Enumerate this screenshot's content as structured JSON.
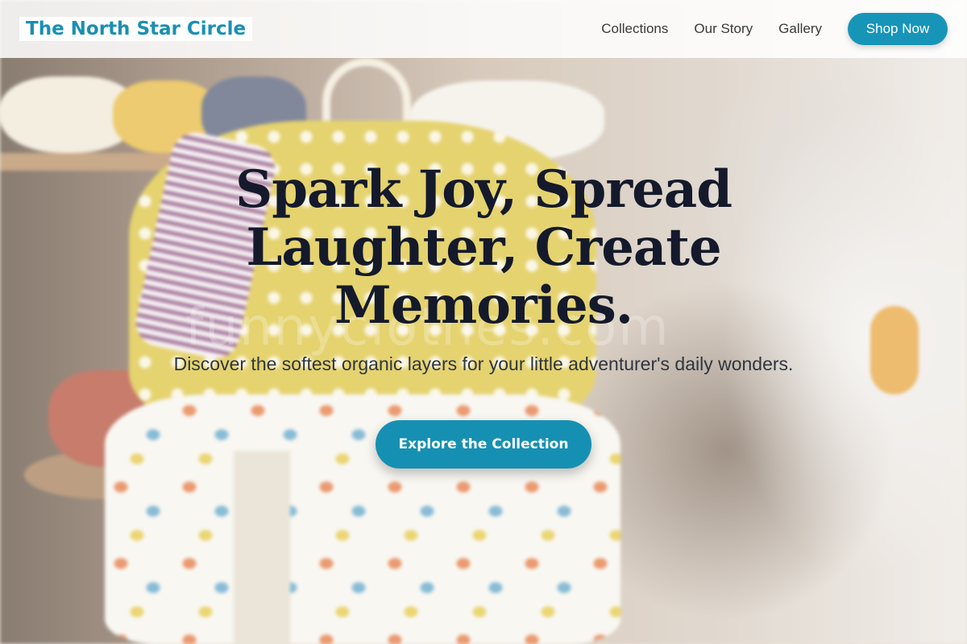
{
  "header": {
    "brand": "The North Star Circle",
    "nav": [
      {
        "label": "Collections"
      },
      {
        "label": "Our Story"
      },
      {
        "label": "Gallery"
      }
    ],
    "cta_label": "Shop Now"
  },
  "hero": {
    "title": "Spark Joy, Spread Laughter, Create Memories.",
    "subtitle": "Discover the softest organic layers for your little adventurer's daily wonders.",
    "cta_label": "Explore the Collection",
    "watermark": "funnyclothes.com"
  },
  "colors": {
    "accent": "#1795b8",
    "brand_text": "#1a8fb3",
    "title_text": "#141a2b"
  }
}
